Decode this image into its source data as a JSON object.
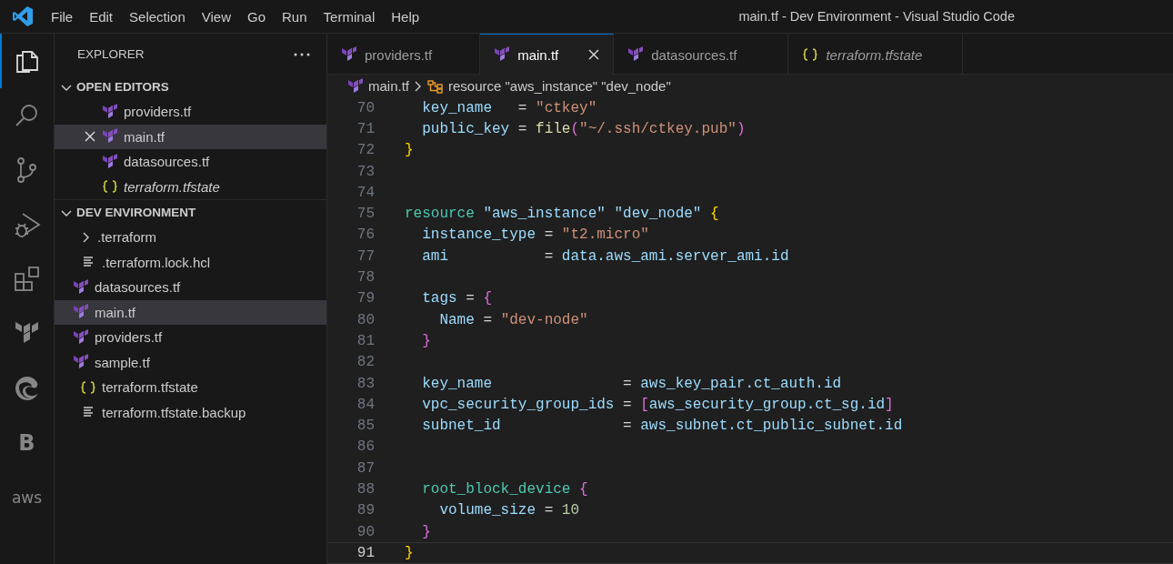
{
  "title_bar": {
    "menu": [
      "File",
      "Edit",
      "Selection",
      "View",
      "Go",
      "Run",
      "Terminal",
      "Help"
    ],
    "title": "main.tf - Dev Environment - Visual Studio Code"
  },
  "activity_bar": [
    {
      "kind": "files",
      "selected": true
    },
    {
      "kind": "search",
      "selected": false
    },
    {
      "kind": "source-control",
      "selected": false
    },
    {
      "kind": "debug",
      "selected": false
    },
    {
      "kind": "extensions",
      "selected": false
    },
    {
      "kind": "terraform",
      "selected": false
    },
    {
      "kind": "edge",
      "selected": false
    },
    {
      "kind": "text",
      "label": "B",
      "selected": false
    },
    {
      "kind": "text",
      "label": "aws",
      "selected": false
    }
  ],
  "sidebar": {
    "title": "EXPLORER",
    "sections": [
      {
        "label": "OPEN EDITORS",
        "expanded": true,
        "items": [
          {
            "name": "providers.tf",
            "kind": "terraform",
            "selected": false,
            "preview": false
          },
          {
            "name": "main.tf",
            "kind": "terraform",
            "selected": true,
            "preview": false
          },
          {
            "name": "datasources.tf",
            "kind": "terraform",
            "selected": false,
            "preview": false
          },
          {
            "name": "terraform.tfstate",
            "kind": "json",
            "selected": false,
            "preview": true
          }
        ]
      },
      {
        "label": "DEV ENVIRONMENT",
        "expanded": true,
        "items": [
          {
            "name": ".terraform",
            "kind": "folder",
            "expanded": false,
            "selected": false
          },
          {
            "name": ".terraform.lock.hcl",
            "kind": "text",
            "selected": false
          },
          {
            "name": "datasources.tf",
            "kind": "terraform",
            "selected": false
          },
          {
            "name": "main.tf",
            "kind": "terraform",
            "selected": true
          },
          {
            "name": "providers.tf",
            "kind": "terraform",
            "selected": false
          },
          {
            "name": "sample.tf",
            "kind": "terraform",
            "selected": false
          },
          {
            "name": "terraform.tfstate",
            "kind": "json",
            "selected": false
          },
          {
            "name": "terraform.tfstate.backup",
            "kind": "text",
            "selected": false
          }
        ]
      }
    ]
  },
  "tabs": [
    {
      "label": "providers.tf",
      "kind": "terraform",
      "selected": false,
      "preview": false
    },
    {
      "label": "main.tf",
      "kind": "terraform",
      "selected": true,
      "preview": false
    },
    {
      "label": "datasources.tf",
      "kind": "terraform",
      "selected": false,
      "preview": false
    },
    {
      "label": "terraform.tfstate",
      "kind": "json",
      "selected": false,
      "preview": true
    }
  ],
  "breadcrumb": [
    {
      "label": "main.tf",
      "kind": "terraform"
    },
    {
      "label": "resource \"aws_instance\" \"dev_node\"",
      "kind": "symbol"
    }
  ],
  "code": [
    {
      "number": "70",
      "current": false,
      "tokens": [
        {
          "kind": "attr",
          "text": "  key_name"
        },
        {
          "kind": "plain",
          "text": "   = "
        },
        {
          "kind": "str",
          "text": "\"ctkey\""
        }
      ]
    },
    {
      "number": "71",
      "current": false,
      "tokens": [
        {
          "kind": "attr",
          "text": "  public_key"
        },
        {
          "kind": "plain",
          "text": " = "
        },
        {
          "kind": "fn",
          "text": "file"
        },
        {
          "kind": "brace2",
          "text": "("
        },
        {
          "kind": "str",
          "text": "\"~/.ssh/ctkey.pub\""
        },
        {
          "kind": "brace2",
          "text": ")"
        }
      ]
    },
    {
      "number": "72",
      "current": false,
      "tokens": [
        {
          "kind": "brace1",
          "text": "}"
        }
      ]
    },
    {
      "number": "73",
      "current": false
    },
    {
      "number": "74",
      "current": false
    },
    {
      "number": "75",
      "current": false,
      "tokens": [
        {
          "kind": "type",
          "text": "resource "
        },
        {
          "kind": "str2",
          "text": "\"aws_instance\" "
        },
        {
          "kind": "str2",
          "text": "\"dev_node\" "
        },
        {
          "kind": "brace1",
          "text": "{"
        }
      ]
    },
    {
      "number": "76",
      "current": false,
      "tokens": [
        {
          "kind": "attr",
          "text": "  instance_type"
        },
        {
          "kind": "plain",
          "text": " = "
        },
        {
          "kind": "str",
          "text": "\"t2.micro\""
        }
      ]
    },
    {
      "number": "77",
      "current": false,
      "tokens": [
        {
          "kind": "attr",
          "text": "  ami"
        },
        {
          "kind": "plain",
          "text": "           = "
        },
        {
          "kind": "attr",
          "text": "data.aws_ami.server_ami.id"
        }
      ]
    },
    {
      "number": "78",
      "current": false
    },
    {
      "number": "79",
      "current": false,
      "tokens": [
        {
          "kind": "attr",
          "text": "  tags"
        },
        {
          "kind": "plain",
          "text": " = "
        },
        {
          "kind": "brace2",
          "text": "{"
        }
      ]
    },
    {
      "number": "80",
      "current": false,
      "tokens": [
        {
          "kind": "attr",
          "text": "    Name"
        },
        {
          "kind": "plain",
          "text": " = "
        },
        {
          "kind": "str",
          "text": "\"dev-node\""
        }
      ]
    },
    {
      "number": "81",
      "current": false,
      "tokens": [
        {
          "kind": "brace2",
          "text": "  }"
        }
      ]
    },
    {
      "number": "82",
      "current": false
    },
    {
      "number": "83",
      "current": false,
      "tokens": [
        {
          "kind": "attr",
          "text": "  key_name"
        },
        {
          "kind": "plain",
          "text": "               = "
        },
        {
          "kind": "attr",
          "text": "aws_key_pair.ct_auth.id"
        }
      ]
    },
    {
      "number": "84",
      "current": false,
      "tokens": [
        {
          "kind": "attr",
          "text": "  vpc_security_group_ids"
        },
        {
          "kind": "plain",
          "text": " = "
        },
        {
          "kind": "brace2",
          "text": "["
        },
        {
          "kind": "attr",
          "text": "aws_security_group.ct_sg.id"
        },
        {
          "kind": "brace2",
          "text": "]"
        }
      ]
    },
    {
      "number": "85",
      "current": false,
      "tokens": [
        {
          "kind": "attr",
          "text": "  subnet_id"
        },
        {
          "kind": "plain",
          "text": "              = "
        },
        {
          "kind": "attr",
          "text": "aws_subnet.ct_public_subnet.id"
        }
      ]
    },
    {
      "number": "86",
      "current": false
    },
    {
      "number": "87",
      "current": false
    },
    {
      "number": "88",
      "current": false,
      "tokens": [
        {
          "kind": "type",
          "text": "  root_block_device "
        },
        {
          "kind": "brace2",
          "text": "{"
        }
      ]
    },
    {
      "number": "89",
      "current": false,
      "tokens": [
        {
          "kind": "attr",
          "text": "    volume_size"
        },
        {
          "kind": "plain",
          "text": " = "
        },
        {
          "kind": "num",
          "text": "10"
        }
      ]
    },
    {
      "number": "90",
      "current": false,
      "tokens": [
        {
          "kind": "brace2",
          "text": "  }"
        }
      ]
    },
    {
      "number": "91",
      "current": true,
      "tokens": [
        {
          "kind": "brace1",
          "text": "}"
        }
      ]
    }
  ]
}
